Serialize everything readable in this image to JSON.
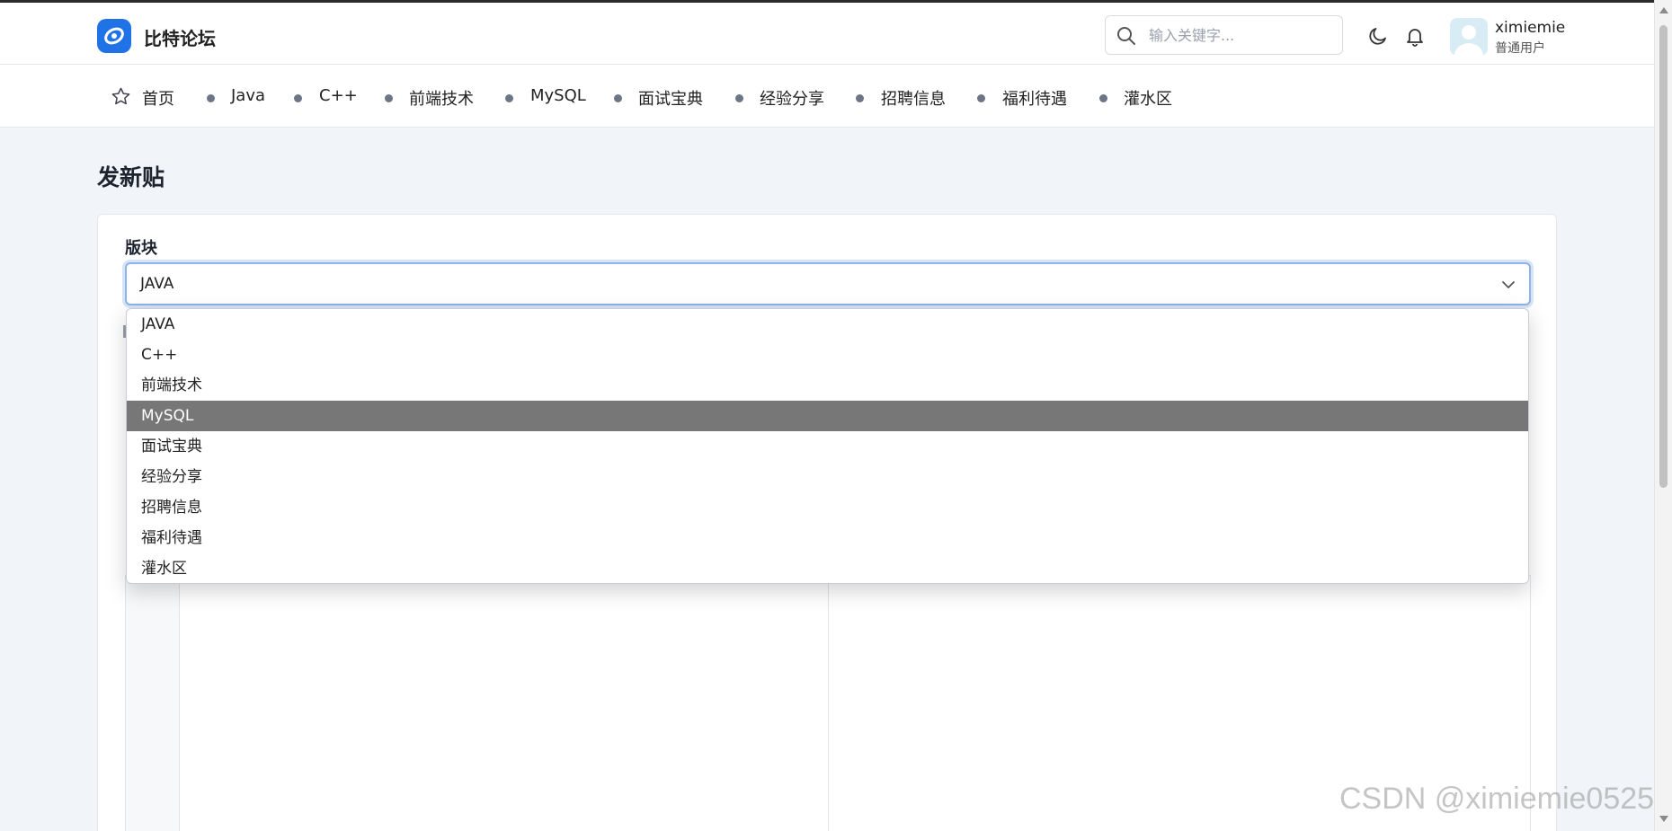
{
  "header": {
    "site_name": "比特论坛",
    "search_placeholder": "输入关键字...",
    "user": {
      "name": "ximiemie",
      "role": "普通用户"
    },
    "icons": [
      "search-icon",
      "moon-icon",
      "bell-icon"
    ]
  },
  "nav": {
    "items": [
      {
        "label": "首页",
        "icon": "star-icon"
      },
      {
        "label": "Java"
      },
      {
        "label": "C++"
      },
      {
        "label": "前端技术"
      },
      {
        "label": "MySQL"
      },
      {
        "label": "面试宝典"
      },
      {
        "label": "经验分享"
      },
      {
        "label": "招聘信息"
      },
      {
        "label": "福利待遇"
      },
      {
        "label": "灌水区"
      }
    ]
  },
  "page": {
    "title": "发新贴",
    "board_label": "版块",
    "board_selected": "JAVA",
    "board_options": [
      "JAVA",
      "C++",
      "前端技术",
      "MySQL",
      "面试宝典",
      "经验分享",
      "招聘信息",
      "福利待遇",
      "灌水区"
    ],
    "highlighted_option": "MySQL"
  },
  "watermark": "CSDN @ximiemie0525",
  "colors": {
    "brand": "#1f73e6",
    "background": "#f1f4f8",
    "highlight": "#777777",
    "focus_border": "#8fb3e8"
  }
}
